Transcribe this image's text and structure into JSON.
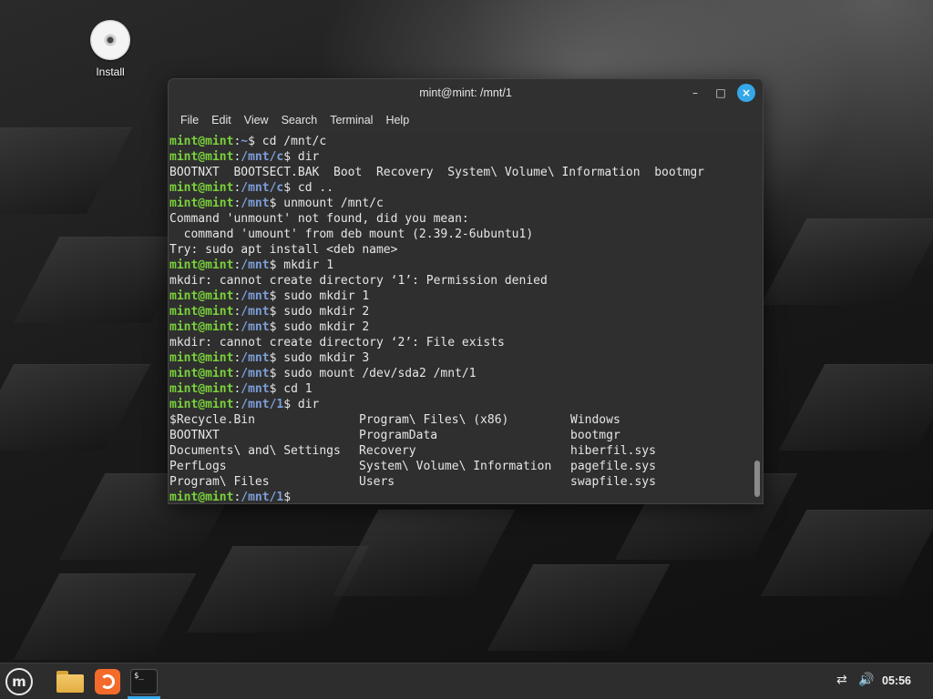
{
  "desktop": {
    "icons": [
      {
        "label": "Install",
        "icon": "disc-icon"
      }
    ]
  },
  "window": {
    "title": "mint@mint: /mnt/1",
    "controls": {
      "minimize": "–",
      "maximize": "□",
      "close": "×"
    },
    "menu": [
      "File",
      "Edit",
      "View",
      "Search",
      "Terminal",
      "Help"
    ]
  },
  "terminal": {
    "prompt_user": "mint@mint",
    "lines": [
      {
        "type": "prompt",
        "path": "~",
        "cmd": " cd /mnt/c"
      },
      {
        "type": "prompt",
        "path": "/mnt/c",
        "cmd": " dir"
      },
      {
        "type": "output",
        "text": "BOOTNXT  BOOTSECT.BAK  Boot  Recovery  System\\ Volume\\ Information  bootmgr"
      },
      {
        "type": "prompt",
        "path": "/mnt/c",
        "cmd": " cd .."
      },
      {
        "type": "prompt",
        "path": "/mnt",
        "cmd": " unmount /mnt/c"
      },
      {
        "type": "output",
        "text": "Command 'unmount' not found, did you mean:"
      },
      {
        "type": "output",
        "text": "  command 'umount' from deb mount (2.39.2-6ubuntu1)"
      },
      {
        "type": "output",
        "text": "Try: sudo apt install <deb name>"
      },
      {
        "type": "prompt",
        "path": "/mnt",
        "cmd": " mkdir 1"
      },
      {
        "type": "output",
        "text": "mkdir: cannot create directory ‘1’: Permission denied"
      },
      {
        "type": "prompt",
        "path": "/mnt",
        "cmd": " sudo mkdir 1"
      },
      {
        "type": "prompt",
        "path": "/mnt",
        "cmd": " sudo mkdir 2"
      },
      {
        "type": "prompt",
        "path": "/mnt",
        "cmd": " sudo mkdir 2"
      },
      {
        "type": "output",
        "text": "mkdir: cannot create directory ‘2’: File exists"
      },
      {
        "type": "prompt",
        "path": "/mnt",
        "cmd": " sudo mkdir 3"
      },
      {
        "type": "prompt",
        "path": "/mnt",
        "cmd": " sudo mount /dev/sda2 /mnt/1"
      },
      {
        "type": "prompt",
        "path": "/mnt",
        "cmd": " cd 1"
      },
      {
        "type": "prompt",
        "path": "/mnt/1",
        "cmd": " dir"
      }
    ],
    "dir_listing": [
      [
        "$Recycle.Bin",
        "Program\\ Files\\ (x86)",
        "Windows"
      ],
      [
        "BOOTNXT",
        "ProgramData",
        "bootmgr"
      ],
      [
        "Documents\\ and\\ Settings",
        "Recovery",
        "hiberfil.sys"
      ],
      [
        "PerfLogs",
        "System\\ Volume\\ Information",
        "pagefile.sys"
      ],
      [
        "Program\\ Files",
        "Users",
        "swapfile.sys"
      ]
    ],
    "final_prompt_path": "/mnt/1",
    "prompt_symbol": "$"
  },
  "taskbar": {
    "items": [
      {
        "name": "mint-menu-button",
        "icon": "mint-logo-icon"
      },
      {
        "name": "files-button",
        "icon": "folder-icon"
      },
      {
        "name": "firefox-button",
        "icon": "firefox-icon"
      },
      {
        "name": "terminal-taskbar-button",
        "icon": "terminal-icon"
      }
    ],
    "mint_glyph": "m",
    "terminal_glyph": "$_",
    "tray": {
      "network_glyph": "⇄",
      "volume_glyph": "🔊"
    },
    "clock": "05:56"
  },
  "colors": {
    "accent": "#35a7e8",
    "prompt_user": "#7ad23b",
    "prompt_path": "#7c9ed8",
    "terminal_bg": "#2f2f2f"
  }
}
